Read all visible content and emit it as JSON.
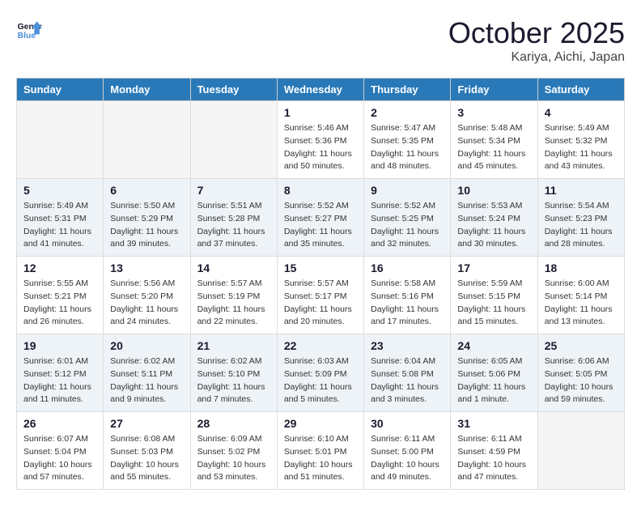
{
  "header": {
    "logo_general": "General",
    "logo_blue": "Blue",
    "month": "October 2025",
    "location": "Kariya, Aichi, Japan"
  },
  "weekdays": [
    "Sunday",
    "Monday",
    "Tuesday",
    "Wednesday",
    "Thursday",
    "Friday",
    "Saturday"
  ],
  "weeks": [
    [
      {
        "day": "",
        "info": ""
      },
      {
        "day": "",
        "info": ""
      },
      {
        "day": "",
        "info": ""
      },
      {
        "day": "1",
        "info": "Sunrise: 5:46 AM\nSunset: 5:36 PM\nDaylight: 11 hours\nand 50 minutes."
      },
      {
        "day": "2",
        "info": "Sunrise: 5:47 AM\nSunset: 5:35 PM\nDaylight: 11 hours\nand 48 minutes."
      },
      {
        "day": "3",
        "info": "Sunrise: 5:48 AM\nSunset: 5:34 PM\nDaylight: 11 hours\nand 45 minutes."
      },
      {
        "day": "4",
        "info": "Sunrise: 5:49 AM\nSunset: 5:32 PM\nDaylight: 11 hours\nand 43 minutes."
      }
    ],
    [
      {
        "day": "5",
        "info": "Sunrise: 5:49 AM\nSunset: 5:31 PM\nDaylight: 11 hours\nand 41 minutes."
      },
      {
        "day": "6",
        "info": "Sunrise: 5:50 AM\nSunset: 5:29 PM\nDaylight: 11 hours\nand 39 minutes."
      },
      {
        "day": "7",
        "info": "Sunrise: 5:51 AM\nSunset: 5:28 PM\nDaylight: 11 hours\nand 37 minutes."
      },
      {
        "day": "8",
        "info": "Sunrise: 5:52 AM\nSunset: 5:27 PM\nDaylight: 11 hours\nand 35 minutes."
      },
      {
        "day": "9",
        "info": "Sunrise: 5:52 AM\nSunset: 5:25 PM\nDaylight: 11 hours\nand 32 minutes."
      },
      {
        "day": "10",
        "info": "Sunrise: 5:53 AM\nSunset: 5:24 PM\nDaylight: 11 hours\nand 30 minutes."
      },
      {
        "day": "11",
        "info": "Sunrise: 5:54 AM\nSunset: 5:23 PM\nDaylight: 11 hours\nand 28 minutes."
      }
    ],
    [
      {
        "day": "12",
        "info": "Sunrise: 5:55 AM\nSunset: 5:21 PM\nDaylight: 11 hours\nand 26 minutes."
      },
      {
        "day": "13",
        "info": "Sunrise: 5:56 AM\nSunset: 5:20 PM\nDaylight: 11 hours\nand 24 minutes."
      },
      {
        "day": "14",
        "info": "Sunrise: 5:57 AM\nSunset: 5:19 PM\nDaylight: 11 hours\nand 22 minutes."
      },
      {
        "day": "15",
        "info": "Sunrise: 5:57 AM\nSunset: 5:17 PM\nDaylight: 11 hours\nand 20 minutes."
      },
      {
        "day": "16",
        "info": "Sunrise: 5:58 AM\nSunset: 5:16 PM\nDaylight: 11 hours\nand 17 minutes."
      },
      {
        "day": "17",
        "info": "Sunrise: 5:59 AM\nSunset: 5:15 PM\nDaylight: 11 hours\nand 15 minutes."
      },
      {
        "day": "18",
        "info": "Sunrise: 6:00 AM\nSunset: 5:14 PM\nDaylight: 11 hours\nand 13 minutes."
      }
    ],
    [
      {
        "day": "19",
        "info": "Sunrise: 6:01 AM\nSunset: 5:12 PM\nDaylight: 11 hours\nand 11 minutes."
      },
      {
        "day": "20",
        "info": "Sunrise: 6:02 AM\nSunset: 5:11 PM\nDaylight: 11 hours\nand 9 minutes."
      },
      {
        "day": "21",
        "info": "Sunrise: 6:02 AM\nSunset: 5:10 PM\nDaylight: 11 hours\nand 7 minutes."
      },
      {
        "day": "22",
        "info": "Sunrise: 6:03 AM\nSunset: 5:09 PM\nDaylight: 11 hours\nand 5 minutes."
      },
      {
        "day": "23",
        "info": "Sunrise: 6:04 AM\nSunset: 5:08 PM\nDaylight: 11 hours\nand 3 minutes."
      },
      {
        "day": "24",
        "info": "Sunrise: 6:05 AM\nSunset: 5:06 PM\nDaylight: 11 hours\nand 1 minute."
      },
      {
        "day": "25",
        "info": "Sunrise: 6:06 AM\nSunset: 5:05 PM\nDaylight: 10 hours\nand 59 minutes."
      }
    ],
    [
      {
        "day": "26",
        "info": "Sunrise: 6:07 AM\nSunset: 5:04 PM\nDaylight: 10 hours\nand 57 minutes."
      },
      {
        "day": "27",
        "info": "Sunrise: 6:08 AM\nSunset: 5:03 PM\nDaylight: 10 hours\nand 55 minutes."
      },
      {
        "day": "28",
        "info": "Sunrise: 6:09 AM\nSunset: 5:02 PM\nDaylight: 10 hours\nand 53 minutes."
      },
      {
        "day": "29",
        "info": "Sunrise: 6:10 AM\nSunset: 5:01 PM\nDaylight: 10 hours\nand 51 minutes."
      },
      {
        "day": "30",
        "info": "Sunrise: 6:11 AM\nSunset: 5:00 PM\nDaylight: 10 hours\nand 49 minutes."
      },
      {
        "day": "31",
        "info": "Sunrise: 6:11 AM\nSunset: 4:59 PM\nDaylight: 10 hours\nand 47 minutes."
      },
      {
        "day": "",
        "info": ""
      }
    ]
  ],
  "row_colors": [
    "#ffffff",
    "#eef3f8",
    "#ffffff",
    "#eef3f8",
    "#ffffff"
  ]
}
